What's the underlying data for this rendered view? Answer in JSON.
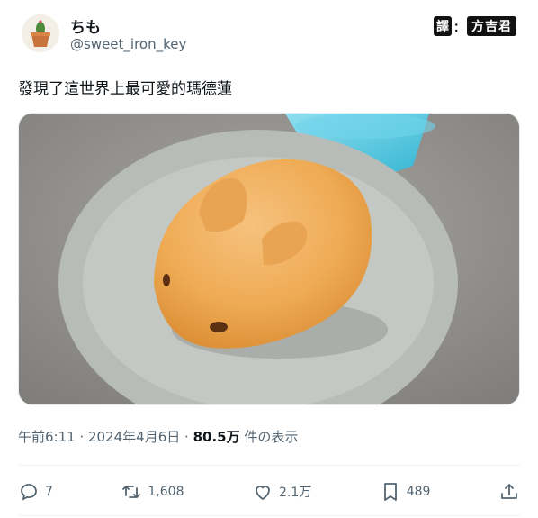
{
  "author": {
    "display_name": "ちも",
    "handle": "@sweet_iron_key"
  },
  "badge": {
    "left": "譯",
    "dot": "：",
    "right": "方吉君"
  },
  "tweet": {
    "text": "發現了這世界上最可愛的瑪德蓮"
  },
  "meta": {
    "time": "午前6:11",
    "sep1": " · ",
    "date": "2024年4月6日",
    "sep2": " · ",
    "views": "80.5万",
    "views_label": " 件の表示"
  },
  "actions": {
    "reply_count": "7",
    "retweet_count": "1,608",
    "like_count": "2.1万",
    "bookmark_count": "489"
  },
  "icons": {
    "reply": "reply-icon",
    "retweet": "retweet-icon",
    "like": "heart-icon",
    "bookmark": "bookmark-icon",
    "share": "share-icon"
  },
  "colors": {
    "text": "#0f1419",
    "secondary": "#536471",
    "divider": "#eff3f4"
  }
}
